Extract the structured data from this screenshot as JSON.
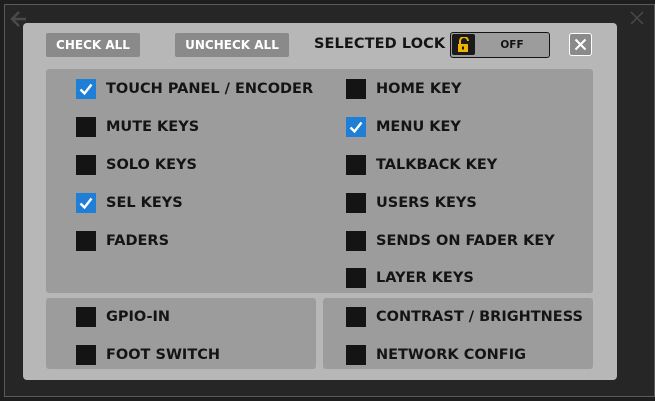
{
  "toolbar": {
    "check_all_label": "CHECK ALL",
    "uncheck_all_label": "UNCHECK ALL",
    "selected_lock_label": "SELECTED LOCK",
    "lock_state": "OFF"
  },
  "colors": {
    "dialog_bg": "#b7b7b7",
    "panel_bg": "#9c9c9c",
    "checkbox_checked": "#1f7fd6",
    "checkbox_unchecked": "#141414",
    "lock_icon": "#f0b400"
  },
  "main_panel": {
    "left_items": [
      {
        "label": "TOUCH PANEL / ENCODER",
        "checked": true
      },
      {
        "label": "MUTE KEYS",
        "checked": false
      },
      {
        "label": "SOLO KEYS",
        "checked": false
      },
      {
        "label": "SEL KEYS",
        "checked": true
      },
      {
        "label": "FADERS",
        "checked": false
      }
    ],
    "right_items": [
      {
        "label": "HOME KEY",
        "checked": false
      },
      {
        "label": "MENU KEY",
        "checked": true
      },
      {
        "label": "TALKBACK KEY",
        "checked": false
      },
      {
        "label": "USERS KEYS",
        "checked": false
      },
      {
        "label": "SENDS ON FADER KEY",
        "checked": false
      },
      {
        "label": "LAYER KEYS",
        "checked": false
      }
    ]
  },
  "bottom_left_panel": {
    "items": [
      {
        "label": "GPIO-IN",
        "checked": false
      },
      {
        "label": "FOOT SWITCH",
        "checked": false
      }
    ]
  },
  "bottom_right_panel": {
    "items": [
      {
        "label": "CONTRAST / BRIGHTNESS",
        "checked": false
      },
      {
        "label": "NETWORK CONFIG",
        "checked": false
      }
    ]
  }
}
